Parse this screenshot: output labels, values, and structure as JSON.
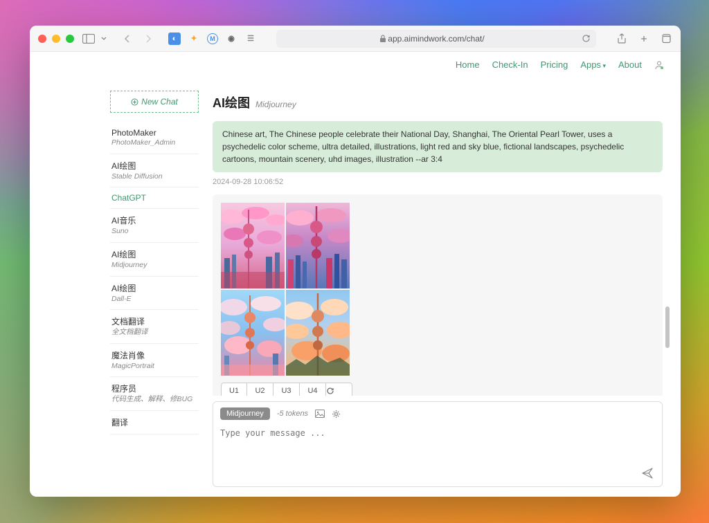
{
  "browser": {
    "url": "app.aimindwork.com/chat/"
  },
  "nav": {
    "home": "Home",
    "checkin": "Check-In",
    "pricing": "Pricing",
    "apps": "Apps",
    "about": "About"
  },
  "sidebar": {
    "new_chat": "New Chat",
    "items": [
      {
        "title": "PhotoMaker",
        "sub": "PhotoMaker_Admin"
      },
      {
        "title": "AI绘图",
        "sub": "Stable Diffusion"
      },
      {
        "title": "ChatGPT",
        "sub": ""
      },
      {
        "title": "AI音乐",
        "sub": "Suno"
      },
      {
        "title": "AI绘图",
        "sub": "Midjourney"
      },
      {
        "title": "AI绘图",
        "sub": "Dall-E"
      },
      {
        "title": "文档翻译",
        "sub": "全文档翻译"
      },
      {
        "title": "魔法肖像",
        "sub": "MagicPortrait"
      },
      {
        "title": "程序员",
        "sub": "代码生成、解释、修BUG"
      },
      {
        "title": "翻译",
        "sub": ""
      }
    ]
  },
  "chat": {
    "title": "AI绘图",
    "subtitle": "Midjourney",
    "prompt": "Chinese art, The Chinese people celebrate their National Day, Shanghai, The Oriental Pearl Tower, uses a psychedelic color scheme, ultra detailed, illustrations, light red and sky blue, fictional landscapes, psychedelic cartoons, mountain scenery, uhd images, illustration --ar 3:4",
    "timestamp": "2024-09-28 10:06:52",
    "buttons": {
      "u1": "U1",
      "u2": "U2",
      "u3": "U3",
      "u4": "U4"
    }
  },
  "input": {
    "model": "Midjourney",
    "tokens": "-5 tokens",
    "placeholder": "Type your message ..."
  }
}
